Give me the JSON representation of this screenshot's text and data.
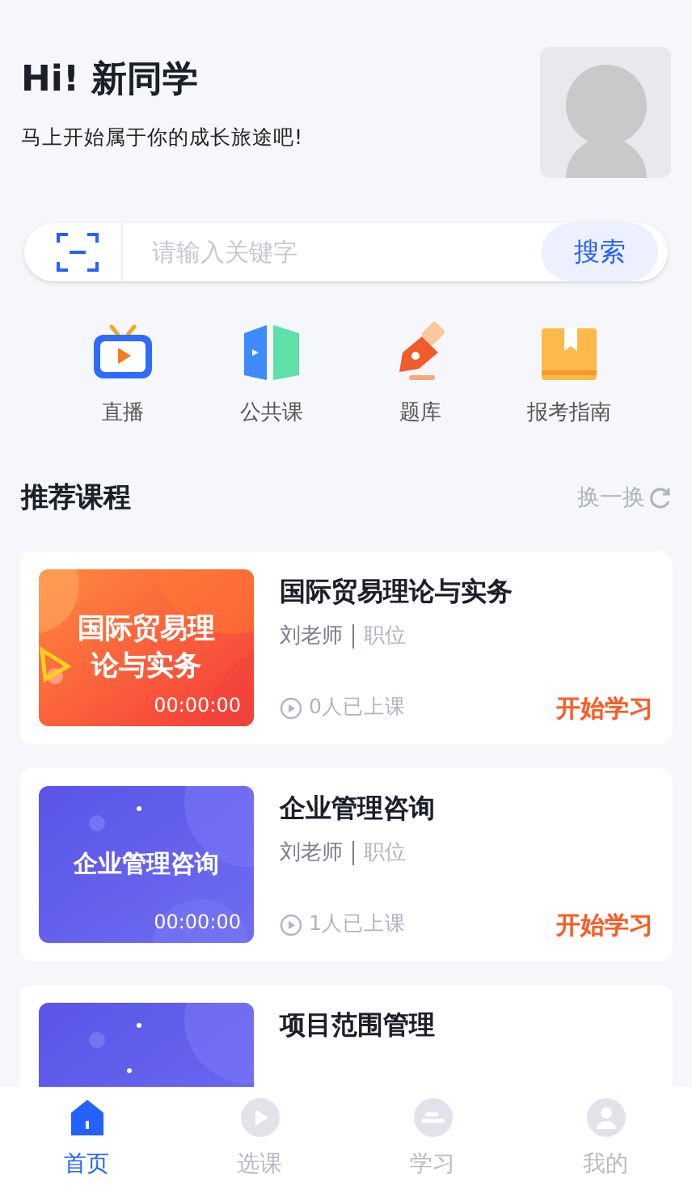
{
  "greeting": {
    "title": "Hi! 新同学",
    "subtitle": "马上开始属于你的成长旅途吧!"
  },
  "search": {
    "placeholder": "请输入关键字",
    "button": "搜索"
  },
  "shortcuts": [
    {
      "kind": "tv",
      "label": "直播"
    },
    {
      "kind": "book",
      "label": "公共课"
    },
    {
      "kind": "pen",
      "label": "题库"
    },
    {
      "kind": "box",
      "label": "报考指南"
    }
  ],
  "section": {
    "title": "推荐课程",
    "action": "换一换"
  },
  "courses": [
    {
      "cover": {
        "kind": "orange",
        "title": "国际贸易理论与实务",
        "duration": "00:00:00"
      },
      "title": "国际贸易理论与实务",
      "teacher": "刘老师",
      "position": "职位",
      "learners": "0人已上课",
      "action": "开始学习"
    },
    {
      "cover": {
        "kind": "purple",
        "title": "企业管理咨询",
        "duration": "00:00:00"
      },
      "title": "企业管理咨询",
      "teacher": "刘老师",
      "position": "职位",
      "learners": "1人已上课",
      "action": "开始学习"
    },
    {
      "cover": {
        "kind": "purple"
      },
      "title": "项目范围管理"
    }
  ],
  "tabs": [
    {
      "kind": "home",
      "label": "首页",
      "selected": true
    },
    {
      "kind": "play",
      "label": "选课",
      "selected": false
    },
    {
      "kind": "study",
      "label": "学习",
      "selected": false
    },
    {
      "kind": "user",
      "label": "我的",
      "selected": false
    }
  ]
}
